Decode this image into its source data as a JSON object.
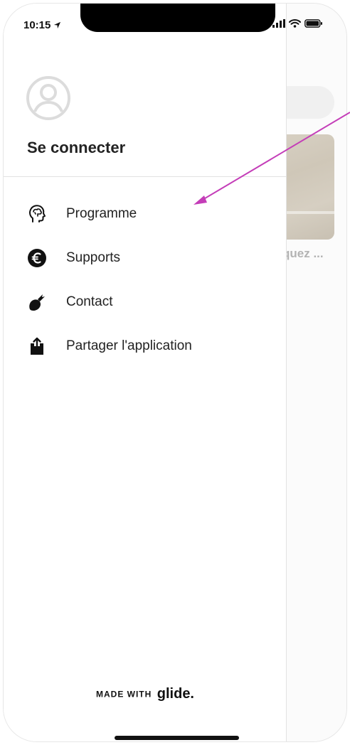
{
  "status_bar": {
    "time": "10:15"
  },
  "drawer": {
    "login_label": "Se connecter",
    "menu_items": [
      {
        "label": "Programme",
        "icon": "head-brain-icon"
      },
      {
        "label": "Supports",
        "icon": "euro-icon"
      },
      {
        "label": "Contact",
        "icon": "contact-icon"
      },
      {
        "label": "Partager l'application",
        "icon": "share-icon"
      }
    ],
    "footer": {
      "made_with": "MADE WITH",
      "brand": "glide."
    }
  },
  "background": {
    "caption": "quez ..."
  },
  "colors": {
    "annotation_arrow": "#c43db8",
    "text": "#222222",
    "divider": "#e2e2e2"
  }
}
